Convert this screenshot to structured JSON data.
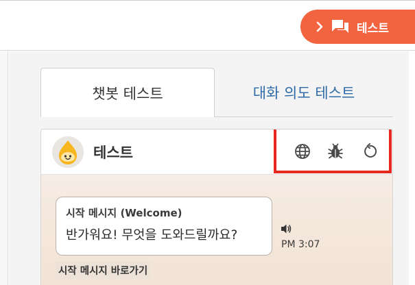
{
  "top_bar": {
    "test_button_label": "테스트",
    "accent_color": "#f2633f"
  },
  "tabs": [
    {
      "label": "챗봇 테스트",
      "active": true
    },
    {
      "label": "대화 의도 테스트",
      "active": false
    }
  ],
  "chat": {
    "bot_name": "테스트",
    "header_icons": [
      "globe-icon",
      "bug-icon",
      "refresh-icon"
    ],
    "highlight_color": "#e8281c",
    "message": {
      "title": "시작 메시지 (Welcome)",
      "text": "반가워요! 무엇을 도와드릴까요?",
      "time": "PM 3:07"
    },
    "shortcut_label": "시작 메시지 바로가기"
  }
}
